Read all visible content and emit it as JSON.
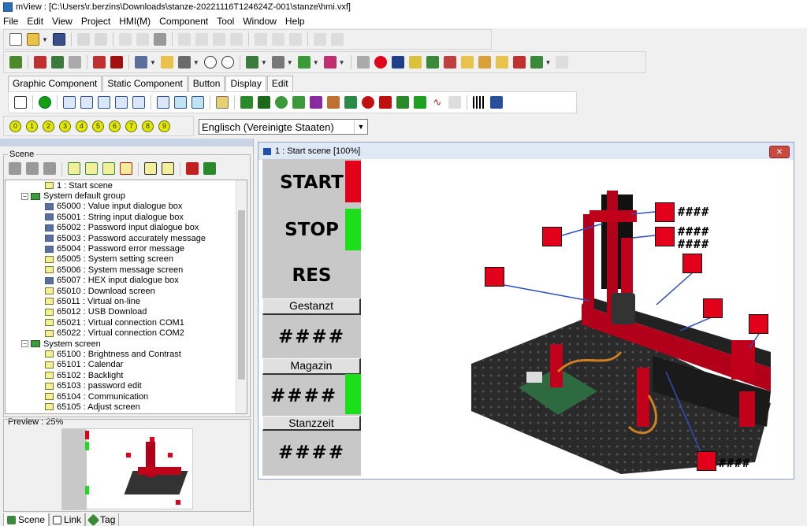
{
  "window": {
    "title": "mView : [C:\\Users\\r.berzins\\Downloads\\stanze-20221116T124624Z-001\\stanze\\hmi.vxf]"
  },
  "menu": [
    "File",
    "Edit",
    "View",
    "Project",
    "HMI(M)",
    "Component",
    "Tool",
    "Window",
    "Help"
  ],
  "component_tabs": [
    "Graphic Component",
    "Static Component",
    "Button",
    "Display",
    "Edit"
  ],
  "active_tab": "Display",
  "numbers_toolbar": [
    "0",
    "1",
    "2",
    "3",
    "4",
    "5",
    "6",
    "7",
    "8",
    "9"
  ],
  "language": "Englisch (Vereinigte Staaten)",
  "scene_panel": {
    "label": "Scene",
    "tree": [
      {
        "level": 2,
        "icon": "yellow",
        "text": "1 : Start scene"
      },
      {
        "level": 0,
        "icon": "folder",
        "toggle": "−",
        "text": "System default group"
      },
      {
        "level": 2,
        "icon": "blue",
        "text": "65000 : Value input dialogue box"
      },
      {
        "level": 2,
        "icon": "blue",
        "text": "65001 : String input dialogue box"
      },
      {
        "level": 2,
        "icon": "blue",
        "text": "65002 : Password input dialogue box"
      },
      {
        "level": 2,
        "icon": "blue",
        "text": "65003 : Password accurately message"
      },
      {
        "level": 2,
        "icon": "blue",
        "text": "65004 : Password error message"
      },
      {
        "level": 2,
        "icon": "yellow",
        "text": "65005 : System setting screen"
      },
      {
        "level": 2,
        "icon": "yellow",
        "text": "65006 : System message screen"
      },
      {
        "level": 2,
        "icon": "blue",
        "text": "65007 : HEX input dialogue box"
      },
      {
        "level": 2,
        "icon": "yellow",
        "text": "65010 : Download screen"
      },
      {
        "level": 2,
        "icon": "yellow",
        "text": "65011 : Virtual on-line"
      },
      {
        "level": 2,
        "icon": "yellow",
        "text": "65012 : USB Download"
      },
      {
        "level": 2,
        "icon": "yellow",
        "text": "65021 : Virtual connection COM1"
      },
      {
        "level": 2,
        "icon": "yellow",
        "text": "65022 : Virtual connection COM2"
      },
      {
        "level": 0,
        "icon": "folder",
        "toggle": "−",
        "text": "System screen"
      },
      {
        "level": 2,
        "icon": "yellow",
        "text": "65100 : Brightness and Contrast"
      },
      {
        "level": 2,
        "icon": "yellow",
        "text": "65101 : Calendar"
      },
      {
        "level": 2,
        "icon": "yellow",
        "text": "65102 : Backlight"
      },
      {
        "level": 2,
        "icon": "yellow",
        "text": "65103 : password edit"
      },
      {
        "level": 2,
        "icon": "yellow",
        "text": "65104 : Communication"
      },
      {
        "level": 2,
        "icon": "yellow",
        "text": "65105 : Adjust screen"
      }
    ]
  },
  "preview": {
    "label": "Preview : 25%"
  },
  "bottom_tabs": [
    "Scene",
    "Link",
    "Tag"
  ],
  "scene_window": {
    "title": "1 : Start scene [100%]"
  },
  "hmi": {
    "start": "START",
    "stop": "STOP",
    "res": "RES",
    "gestanzt": "Gestanzt",
    "magazin": "Magazin",
    "stanzzeit": "Stanzzeit",
    "hash": "####",
    "colors": {
      "start_indicator": "#e3001a",
      "stop_indicator": "#1adf1a",
      "magazin_indicator": "#1adf1a",
      "marker": "#e3001a"
    }
  }
}
